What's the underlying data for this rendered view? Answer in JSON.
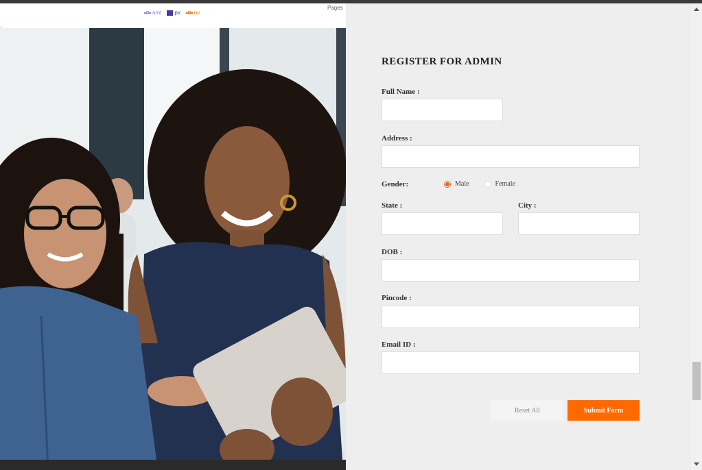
{
  "chart": {
    "legend": [
      {
        "name": "amt",
        "color": "#8884d8",
        "marker": "line"
      },
      {
        "name": "pv",
        "color": "#413ea0",
        "marker": "box"
      },
      {
        "name": "uv",
        "color": "#ff7300",
        "marker": "line"
      }
    ],
    "axis_label": "Pages"
  },
  "photo": {
    "icon": "teacher-student-tablet-photo"
  },
  "form": {
    "title": "REGISTER FOR ADMIN",
    "full_name": {
      "label": "Full Name :",
      "value": ""
    },
    "address": {
      "label": "Address :",
      "value": ""
    },
    "gender": {
      "label": "Gender:",
      "options": [
        "Male",
        "Female"
      ],
      "selected": "Male"
    },
    "state": {
      "label": "State :",
      "value": ""
    },
    "city": {
      "label": "City :",
      "value": ""
    },
    "dob": {
      "label": "DOB :",
      "value": ""
    },
    "pincode": {
      "label": "Pincode :",
      "value": ""
    },
    "email": {
      "label": "Email ID :",
      "value": ""
    },
    "reset_label": "Reset All",
    "submit_label": "Submit Form",
    "accent": "#ff6a00"
  }
}
